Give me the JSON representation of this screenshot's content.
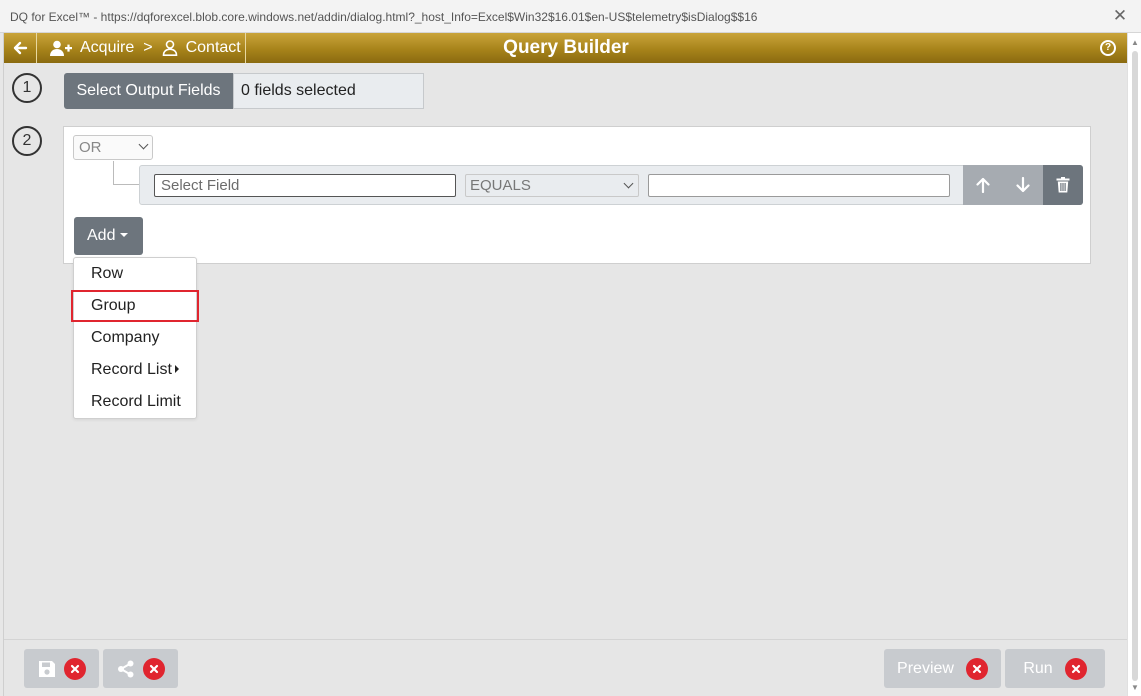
{
  "window": {
    "title": "DQ for Excel™ - https://dqforexcel.blob.core.windows.net/addin/dialog.html?_host_Info=Excel$Win32$16.01$en-US$telemetry$isDialog$$16",
    "close_glyph": "✕"
  },
  "header": {
    "breadcrumb_1": "Acquire",
    "breadcrumb_sep": ">",
    "breadcrumb_2": "Contact",
    "title": "Query Builder",
    "help_glyph": "?",
    "accent_color": "#a7831a"
  },
  "steps": {
    "one": "1",
    "two": "2"
  },
  "output_fields": {
    "button_label": "Select Output Fields",
    "status": "0 fields selected"
  },
  "query": {
    "logic_selected": "OR",
    "row": {
      "field_placeholder": "Select Field",
      "operator_selected": "EQUALS",
      "value": ""
    },
    "add_label": "Add"
  },
  "add_menu": {
    "items": [
      "Row",
      "Group",
      "Company",
      "Record List",
      "Record Limit"
    ],
    "highlighted": "Group",
    "highlight_color": "#e0252f"
  },
  "footer": {
    "preview_label": "Preview",
    "run_label": "Run",
    "disabled_color": "#c8cbcf",
    "icons": [
      "save-icon",
      "share-icon",
      "cancel-x-icon"
    ]
  }
}
